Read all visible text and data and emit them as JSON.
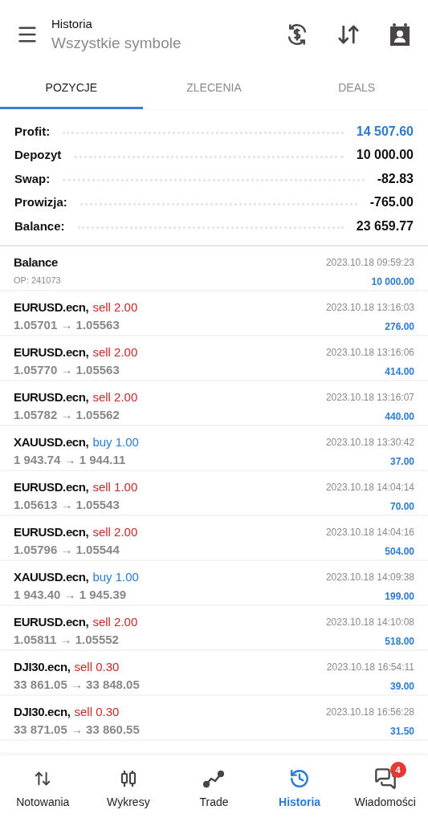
{
  "header": {
    "title": "Historia",
    "subtitle": "Wszystkie symbole"
  },
  "tabs": [
    {
      "label": "POZYCJE",
      "selected": true
    },
    {
      "label": "ZLECENIA",
      "selected": false
    },
    {
      "label": "DEALS",
      "selected": false
    }
  ],
  "summary": [
    {
      "label": "Profit:",
      "value": "14 507.60",
      "color": "#2a7bd6"
    },
    {
      "label": "Depozyt",
      "value": "10 000.00",
      "color": "#111111"
    },
    {
      "label": "Swap:",
      "value": "-82.83",
      "color": "#111111"
    },
    {
      "label": "Prowizja:",
      "value": "-765.00",
      "color": "#111111"
    },
    {
      "label": "Balance:",
      "value": "23 659.77",
      "color": "#111111"
    }
  ],
  "rows": [
    {
      "kind": "balance",
      "symbol": "Balance",
      "detail": "OP: 241073",
      "time": "2023.10.18 09:59:23",
      "amount": "10 000.00"
    },
    {
      "kind": "sell",
      "symbol": "EURUSD.ecn,",
      "action": "sell 2.00",
      "detail": "1.05701 → 1.05563",
      "time": "2023.10.18 13:16:03",
      "amount": "276.00"
    },
    {
      "kind": "sell",
      "symbol": "EURUSD.ecn,",
      "action": "sell 2.00",
      "detail": "1.05770 → 1.05563",
      "time": "2023.10.18 13:16:06",
      "amount": "414.00"
    },
    {
      "kind": "sell",
      "symbol": "EURUSD.ecn,",
      "action": "sell 2.00",
      "detail": "1.05782 → 1.05562",
      "time": "2023.10.18 13:16:07",
      "amount": "440.00"
    },
    {
      "kind": "buy",
      "symbol": "XAUUSD.ecn,",
      "action": "buy 1.00",
      "detail": "1 943.74 → 1 944.11",
      "time": "2023.10.18 13:30:42",
      "amount": "37.00"
    },
    {
      "kind": "sell",
      "symbol": "EURUSD.ecn,",
      "action": "sell 1.00",
      "detail": "1.05613 → 1.05543",
      "time": "2023.10.18 14:04:14",
      "amount": "70.00"
    },
    {
      "kind": "sell",
      "symbol": "EURUSD.ecn,",
      "action": "sell 2.00",
      "detail": "1.05796 → 1.05544",
      "time": "2023.10.18 14:04:16",
      "amount": "504.00"
    },
    {
      "kind": "buy",
      "symbol": "XAUUSD.ecn,",
      "action": "buy 1.00",
      "detail": "1 943.40 → 1 945.39",
      "time": "2023.10.18 14:09:38",
      "amount": "199.00"
    },
    {
      "kind": "sell",
      "symbol": "EURUSD.ecn,",
      "action": "sell 2.00",
      "detail": "1.05811 → 1.05552",
      "time": "2023.10.18 14:10:08",
      "amount": "518.00"
    },
    {
      "kind": "sell",
      "symbol": "DJI30.ecn,",
      "action": "sell 0.30",
      "detail": "33 861.05 → 33 848.05",
      "time": "2023.10.18 16:54:11",
      "amount": "39.00"
    },
    {
      "kind": "sell",
      "symbol": "DJI30.ecn,",
      "action": "sell 0.30",
      "detail": "33 871.05 → 33 860.55",
      "time": "2023.10.18 16:56:28",
      "amount": "31.50"
    }
  ],
  "nav": [
    {
      "kind": "quotes",
      "label": "Notowania",
      "selected": false
    },
    {
      "kind": "charts",
      "label": "Wykresy",
      "selected": false
    },
    {
      "kind": "trade",
      "label": "Trade",
      "selected": false
    },
    {
      "kind": "history",
      "label": "Historia",
      "selected": true
    },
    {
      "kind": "messages",
      "label": "Wiadomości",
      "selected": false,
      "badge": "4"
    }
  ]
}
